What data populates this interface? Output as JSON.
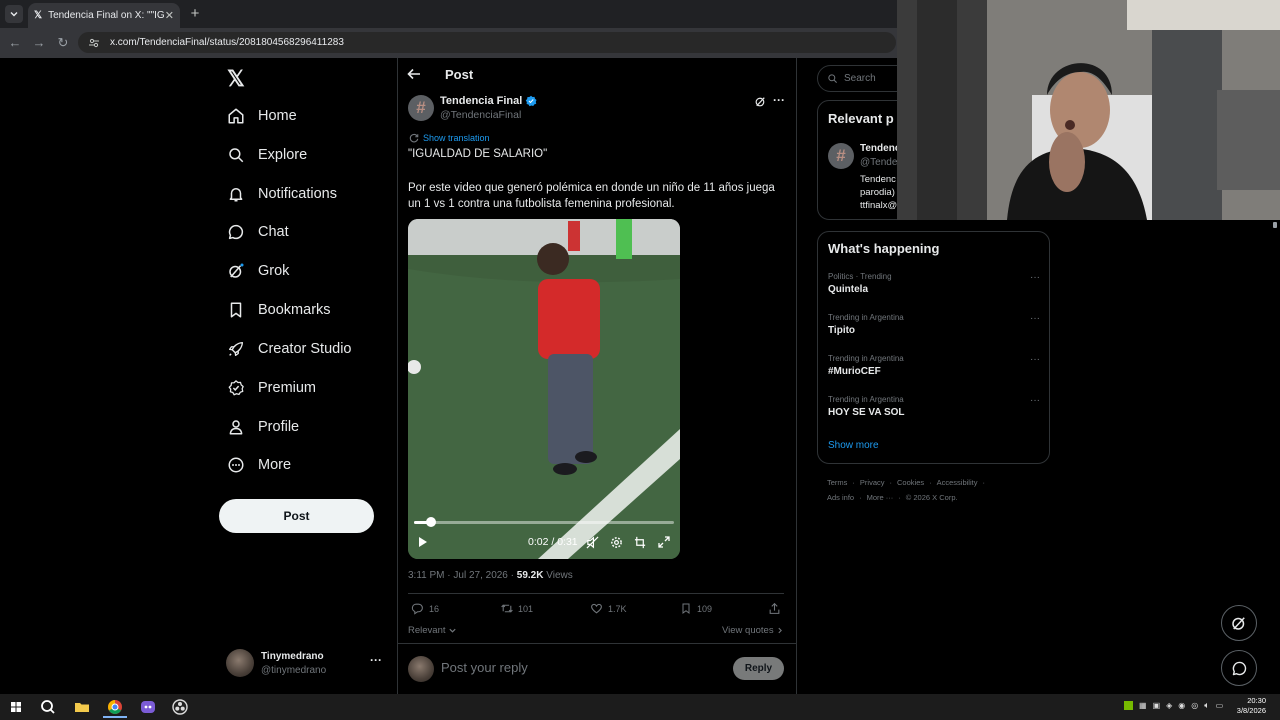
{
  "browser": {
    "tab_title": "Tendencia Final on X: \"\"IGUALD",
    "url": "x.com/TendenciaFinal/status/2081804568296411283",
    "new_tab": "+"
  },
  "nav": {
    "items": [
      {
        "label": "Home",
        "icon": "home-icon"
      },
      {
        "label": "Explore",
        "icon": "search-icon"
      },
      {
        "label": "Notifications",
        "icon": "bell-icon"
      },
      {
        "label": "Chat",
        "icon": "chat-bubble-icon"
      },
      {
        "label": "Grok",
        "icon": "grok-icon"
      },
      {
        "label": "Bookmarks",
        "icon": "bookmark-icon"
      },
      {
        "label": "Creator Studio",
        "icon": "rocket-icon"
      },
      {
        "label": "Premium",
        "icon": "verified-badge-icon"
      },
      {
        "label": "Profile",
        "icon": "person-icon"
      },
      {
        "label": "More",
        "icon": "more-circle-icon"
      }
    ],
    "post_button": "Post",
    "account": {
      "name": "Tinymedrano",
      "handle": "@tinymedrano",
      "menu": "···"
    }
  },
  "post": {
    "header_title": "Post",
    "author_name": "Tendencia Final",
    "author_handle": "@TendenciaFinal",
    "show_translation": "Show translation",
    "text_line1": "\"IGUALDAD DE SALARIO\"",
    "text_line2": "Por este video que generó polémica en donde un niño de 11 años juega un 1 vs 1 contra una futbolista femenina profesional.",
    "video": {
      "time": "0:02 / 0:31",
      "progress": 0.065
    },
    "timestamp": "3:11 PM · Jul 27, 2026 · ",
    "views_count": "59.2K",
    "views_label": " Views",
    "stats": {
      "replies": "16",
      "reposts": "101",
      "likes": "1.7K",
      "bookmarks": "109"
    },
    "sort_label": "Relevant",
    "view_quotes": "View quotes",
    "reply_placeholder": "Post your reply",
    "reply_button": "Reply"
  },
  "right": {
    "search_placeholder": "Search",
    "relevant_title": "Relevant p",
    "relevant_person": {
      "name": "Tendenc",
      "handle": "@Tende",
      "bio1": "Tendenc",
      "bio2": "parodia)",
      "bio3": "ttfinalx@"
    },
    "whats_happening": "What's happening",
    "trends": [
      {
        "meta": "Politics · Trending",
        "title": "Quintela"
      },
      {
        "meta": "Trending in Argentina",
        "title": "Tipito"
      },
      {
        "meta": "Trending in Argentina",
        "title": "#MurioCEF"
      },
      {
        "meta": "Trending in Argentina",
        "title": "HOY SE VA SOL"
      }
    ],
    "show_more": "Show more",
    "footer_line1": [
      "Terms",
      "Privacy",
      "Cookies",
      "Accessibility"
    ],
    "footer_line2": [
      "Ads info",
      "More ···",
      "© 2026 X Corp."
    ]
  },
  "taskbar": {
    "time": "20:30",
    "date": "3/8/2026"
  },
  "colors": {
    "accent": "#1d9bf0",
    "background": "#000000",
    "border": "#2f3336",
    "muted": "#71767b"
  }
}
